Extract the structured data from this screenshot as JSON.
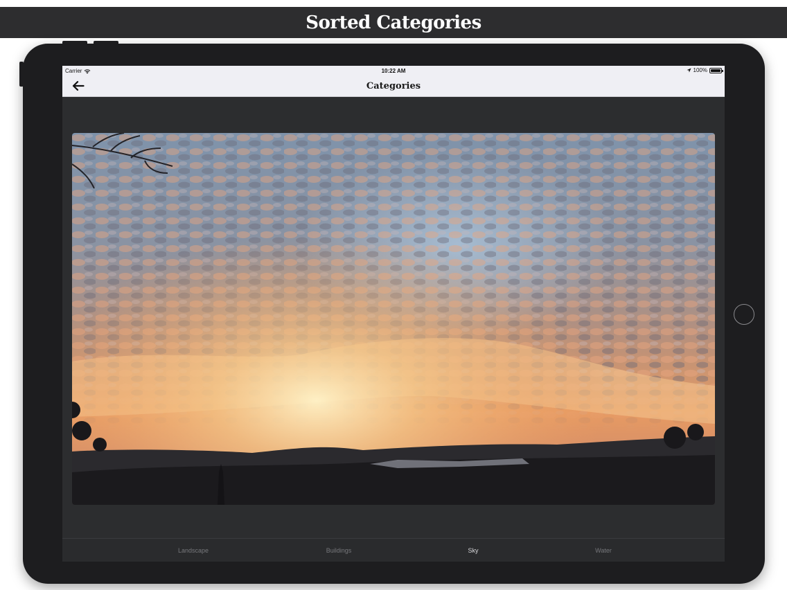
{
  "banner": {
    "title": "Sorted Categories"
  },
  "status_bar": {
    "carrier": "Carrier",
    "time": "10:22 AM",
    "battery": "100%",
    "icons": [
      "wifi-icon",
      "location-icon",
      "battery-icon"
    ]
  },
  "nav_bar": {
    "title": "Categories",
    "back_icon": "arrow-left-icon"
  },
  "photo": {
    "subject": "sunset sky with clouds"
  },
  "tabs": [
    {
      "label": "Landscape",
      "selected": false
    },
    {
      "label": "Buildings",
      "selected": false
    },
    {
      "label": "Sky",
      "selected": true
    },
    {
      "label": "Water",
      "selected": false
    }
  ],
  "colors": {
    "banner_bg": "#2d2d2f",
    "device_frame": "#1d1d1f",
    "screen_bg": "#2c2d2f",
    "nav_bg": "#efeff4",
    "tab_active": "#d9d9dc",
    "tab_inactive": "#77787c"
  }
}
